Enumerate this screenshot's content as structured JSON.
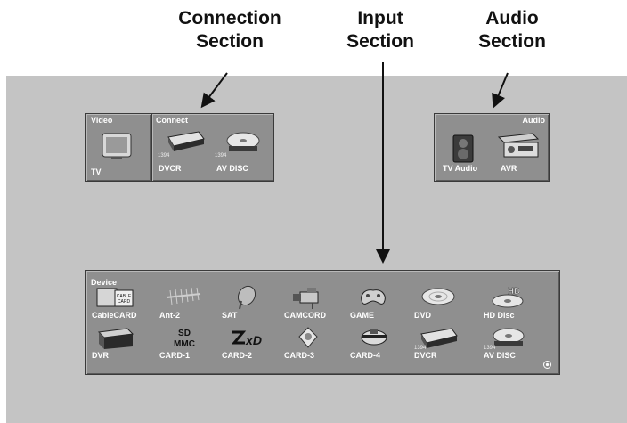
{
  "callouts": {
    "connection": [
      "Connection",
      "Section"
    ],
    "input": [
      "Input",
      "Section"
    ],
    "audio": [
      "Audio",
      "Section"
    ]
  },
  "video_panel": {
    "title": "Video",
    "items": [
      {
        "label": "TV",
        "icon": "tv-icon"
      }
    ]
  },
  "connect_panel": {
    "title": "Connect",
    "items": [
      {
        "label": "DVCR",
        "sub": "1394",
        "icon": "dvcr-icon"
      },
      {
        "label": "AV DISC",
        "sub": "1394",
        "icon": "av-disc-icon"
      }
    ]
  },
  "audio_panel": {
    "title": "Audio",
    "items": [
      {
        "label": "TV Audio",
        "icon": "tv-audio-icon"
      },
      {
        "label": "AVR",
        "icon": "avr-icon"
      }
    ]
  },
  "device_panel": {
    "title": "Device",
    "row1": [
      {
        "label": "CableCARD",
        "icon": "cablecard-icon"
      },
      {
        "label": "Ant-2",
        "icon": "antenna-icon"
      },
      {
        "label": "SAT",
        "icon": "satellite-dish-icon"
      },
      {
        "label": "CAMCORD",
        "icon": "camcorder-icon"
      },
      {
        "label": "GAME",
        "icon": "game-controller-icon"
      },
      {
        "label": "DVD",
        "icon": "dvd-disc-icon"
      },
      {
        "label": "HD Disc",
        "icon": "hd-disc-icon"
      }
    ],
    "row2": [
      {
        "label": "DVR",
        "icon": "dvr-icon"
      },
      {
        "label": "CARD-1",
        "icon": "sd-mmc-card-icon",
        "icon_text": "SD MMC"
      },
      {
        "label": "CARD-2",
        "icon": "xd-card-icon",
        "icon_text": "xD"
      },
      {
        "label": "CARD-3",
        "icon": "card-3-icon"
      },
      {
        "label": "CARD-4",
        "icon": "card-4-icon"
      },
      {
        "label": "DVCR",
        "sub": "1394",
        "icon": "dvcr-icon"
      },
      {
        "label": "AV DISC",
        "sub": "1394",
        "icon": "av-disc-icon"
      }
    ]
  }
}
